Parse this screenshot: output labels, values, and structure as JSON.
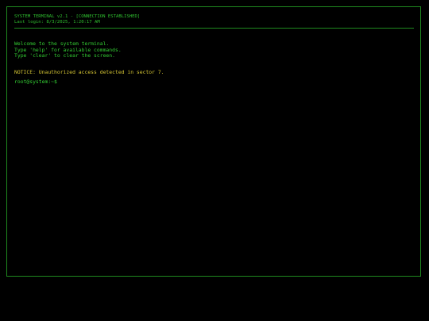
{
  "header": {
    "title": "SYSTEM TERMINAL v2.1 - [CONNECTION ESTABLISHED]",
    "last_login": "Last login: 8/3/2025, 1:20:17 AM"
  },
  "output": {
    "lines": [
      "Welcome to the system terminal.",
      "Type 'help' for available commands.",
      "Type 'clear' to clear the screen."
    ],
    "notice": "NOTICE: Unauthorized access detected in sector 7."
  },
  "prompt": {
    "text": "root@system:~$",
    "input_value": ""
  },
  "colors": {
    "text": "#33cc33",
    "notice": "#d6c634",
    "border": "#1f8a1f",
    "background": "#000000"
  }
}
